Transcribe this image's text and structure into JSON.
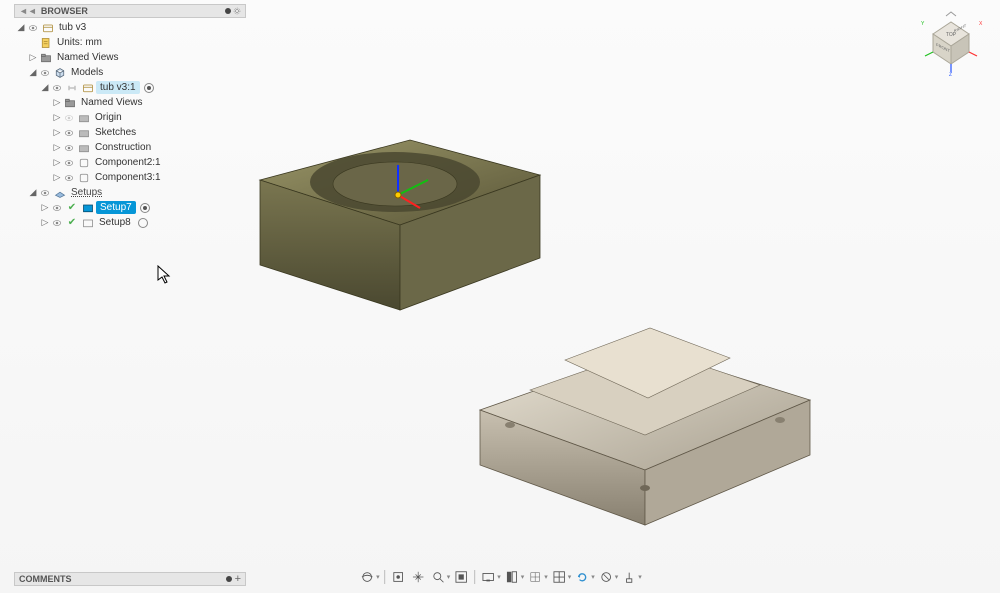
{
  "panels": {
    "browser": "BROWSER",
    "comments": "COMMENTS"
  },
  "tree": {
    "root": {
      "label": "tub v3"
    },
    "units": {
      "label": "Units: mm"
    },
    "named_views": {
      "label": "Named Views"
    },
    "models": {
      "label": "Models"
    },
    "model_instance": {
      "label": "tub v3:1"
    },
    "named_views2": {
      "label": "Named Views"
    },
    "origin": {
      "label": "Origin"
    },
    "sketches": {
      "label": "Sketches"
    },
    "construction": {
      "label": "Construction"
    },
    "component2": {
      "label": "Component2:1"
    },
    "component3": {
      "label": "Component3:1"
    },
    "setups": {
      "label": "Setups"
    },
    "setup7": {
      "label": "Setup7"
    },
    "setup8": {
      "label": "Setup8"
    }
  },
  "viewcube": {
    "top": "TOP",
    "front": "FRONT",
    "right": "RIGHT",
    "axes": {
      "x": "X",
      "y": "Y",
      "z": "Z"
    }
  },
  "toolbar": {
    "items": [
      "orbit",
      "look-at",
      "pan",
      "zoom",
      "fit",
      "display",
      "visual-style",
      "grid",
      "snap",
      "effects",
      "object-visibility",
      "slice"
    ]
  }
}
